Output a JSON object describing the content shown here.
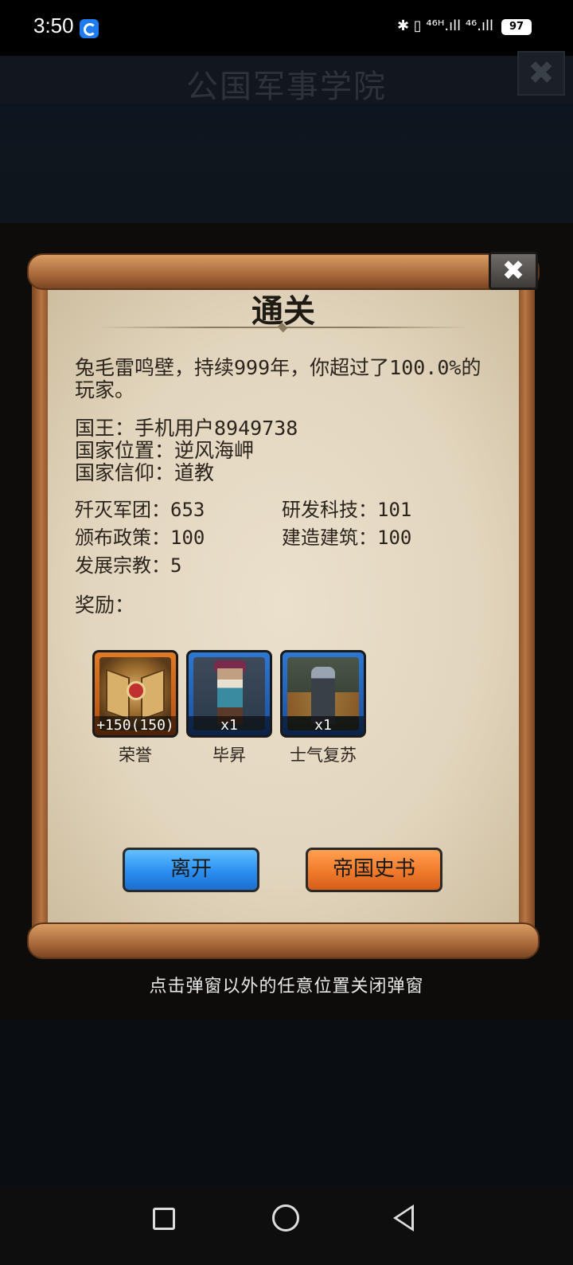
{
  "status_bar": {
    "time": "3:50",
    "signal_text": "✱ ▯ ⁴⁶ᴴ.ıll ⁴⁶.ıll",
    "battery": "97"
  },
  "background": {
    "title": "公国军事学院",
    "close_glyph": "✖"
  },
  "dialog": {
    "title": "通关",
    "close_glyph": "✖",
    "summary": "兔毛雷鸣壁，持续999年，你超过了100.0%的玩家。",
    "info": [
      "国王：手机用户8949738",
      "国家位置：逆风海岬",
      "国家信仰：道教"
    ],
    "stats": [
      "歼灭军团：653",
      "研发科技：101",
      "颁布政策：100",
      "建造建筑：100",
      "发展宗教：5"
    ],
    "rewards_label": "奖励：",
    "rewards": [
      {
        "name": "荣誉",
        "badge": "+150(150)",
        "icon": "honor-emblem-icon",
        "frame": "orange"
      },
      {
        "name": "毕昇",
        "badge": "x1",
        "icon": "hero-portrait-icon",
        "frame": "blue"
      },
      {
        "name": "士气复苏",
        "badge": "x1",
        "icon": "morale-card-icon",
        "frame": "blue"
      }
    ],
    "buttons": {
      "leave": "离开",
      "history": "帝国史书"
    }
  },
  "hint": "点击弹窗以外的任意位置关闭弹窗",
  "colors": {
    "leave_button": "#2a8ef0",
    "history_button": "#f07a2a",
    "paper": "#e6dac4"
  }
}
